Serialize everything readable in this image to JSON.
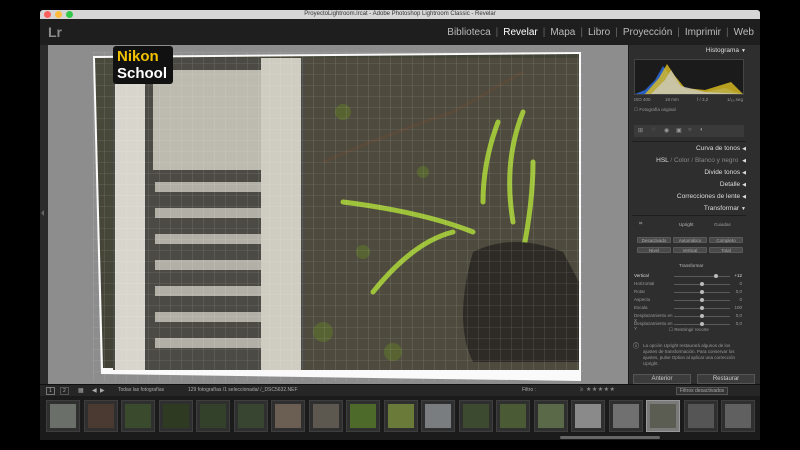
{
  "window": {
    "title": "ProyectoLightroom.lrcat - Adobe Photoshop Lightroom Classic - Revelar"
  },
  "app": {
    "logo": "Lr"
  },
  "watermark": {
    "line1": "Nikon",
    "line2": "School"
  },
  "modules": [
    {
      "label": "Biblioteca",
      "active": false
    },
    {
      "label": "Revelar",
      "active": true
    },
    {
      "label": "Mapa",
      "active": false
    },
    {
      "label": "Libro",
      "active": false
    },
    {
      "label": "Proyección",
      "active": false
    },
    {
      "label": "Imprimir",
      "active": false
    },
    {
      "label": "Web",
      "active": false
    }
  ],
  "panels": {
    "histogram": {
      "title": "Histograma",
      "iso": "ISO 400",
      "focal": "18 mm",
      "aperture": "f / 3,2",
      "shutter": "1/₆₀ seg",
      "original_label": "Fotografía original"
    },
    "tone_curve": "Curva de tonos",
    "hsl": {
      "hsl": "HSL",
      "color": "Color",
      "bw": "Blanco y negro",
      "sep1": "/",
      "sep2": "/"
    },
    "split_toning": "Divide tonos",
    "detail": "Detalle",
    "lens": "Correcciones de lente",
    "transform": {
      "title": "Transformar",
      "upright_label": "Upright",
      "guided_label": "Guiadas",
      "buttons": [
        "Desactivado",
        "Automático",
        "Completo",
        "Nivel",
        "Vertical",
        "Total"
      ],
      "section_label": "Transformar",
      "sliders": [
        {
          "label": "Vertical",
          "value": "+12",
          "active": true
        },
        {
          "label": "Horizontal",
          "value": "0",
          "active": false
        },
        {
          "label": "Rotar",
          "value": "0,0",
          "active": false
        },
        {
          "label": "Aspecto",
          "value": "0",
          "active": false
        },
        {
          "label": "Escala",
          "value": "100",
          "active": false
        },
        {
          "label": "Desplazamiento en X",
          "value": "0,0",
          "active": false
        },
        {
          "label": "Desplazamiento en Y",
          "value": "0,0",
          "active": false
        }
      ],
      "constrain_crop": "Restringir recorte",
      "note": "La opción Upright restaurará algunos de los ajustes de transformación. Para conservar los ajustes, pulse Option al aplicar una corrección Upright."
    },
    "buttons": {
      "previous": "Anterior",
      "reset": "Restaurar"
    }
  },
  "filmstrip": {
    "page1": "1",
    "page2": "2",
    "source": "Todas las fotografías",
    "count": "129 fotografías /1 seleccionada/ /_DSC5632.NEF",
    "filter_label": "Filtro :",
    "filter_menu": "Filtros desactivados",
    "thumbs": [
      {
        "color": "#6a6f6a",
        "selected": false
      },
      {
        "color": "#4a3a32",
        "selected": false
      },
      {
        "color": "#3a4a2c",
        "selected": false
      },
      {
        "color": "#2e3a22",
        "selected": false
      },
      {
        "color": "#33402a",
        "selected": false
      },
      {
        "color": "#384530",
        "selected": false
      },
      {
        "color": "#6a5f52",
        "selected": false
      },
      {
        "color": "#5c5850",
        "selected": false
      },
      {
        "color": "#4d6a2a",
        "selected": false
      },
      {
        "color": "#6a7a38",
        "selected": false
      },
      {
        "color": "#7a7d80",
        "selected": false
      },
      {
        "color": "#3c4a30",
        "selected": false
      },
      {
        "color": "#4a5a34",
        "selected": false
      },
      {
        "color": "#5a6a48",
        "selected": false
      },
      {
        "color": "#8a8a8a",
        "selected": false
      },
      {
        "color": "#707070",
        "selected": false
      },
      {
        "color": "#5b5d52",
        "selected": true
      },
      {
        "color": "#555555",
        "selected": false
      },
      {
        "color": "#606060",
        "selected": false
      }
    ]
  },
  "colors": {
    "accent_yellow": "#f2c200",
    "panel_bg": "#2e2e2e",
    "workspace_bg": "#8d8d8d"
  }
}
